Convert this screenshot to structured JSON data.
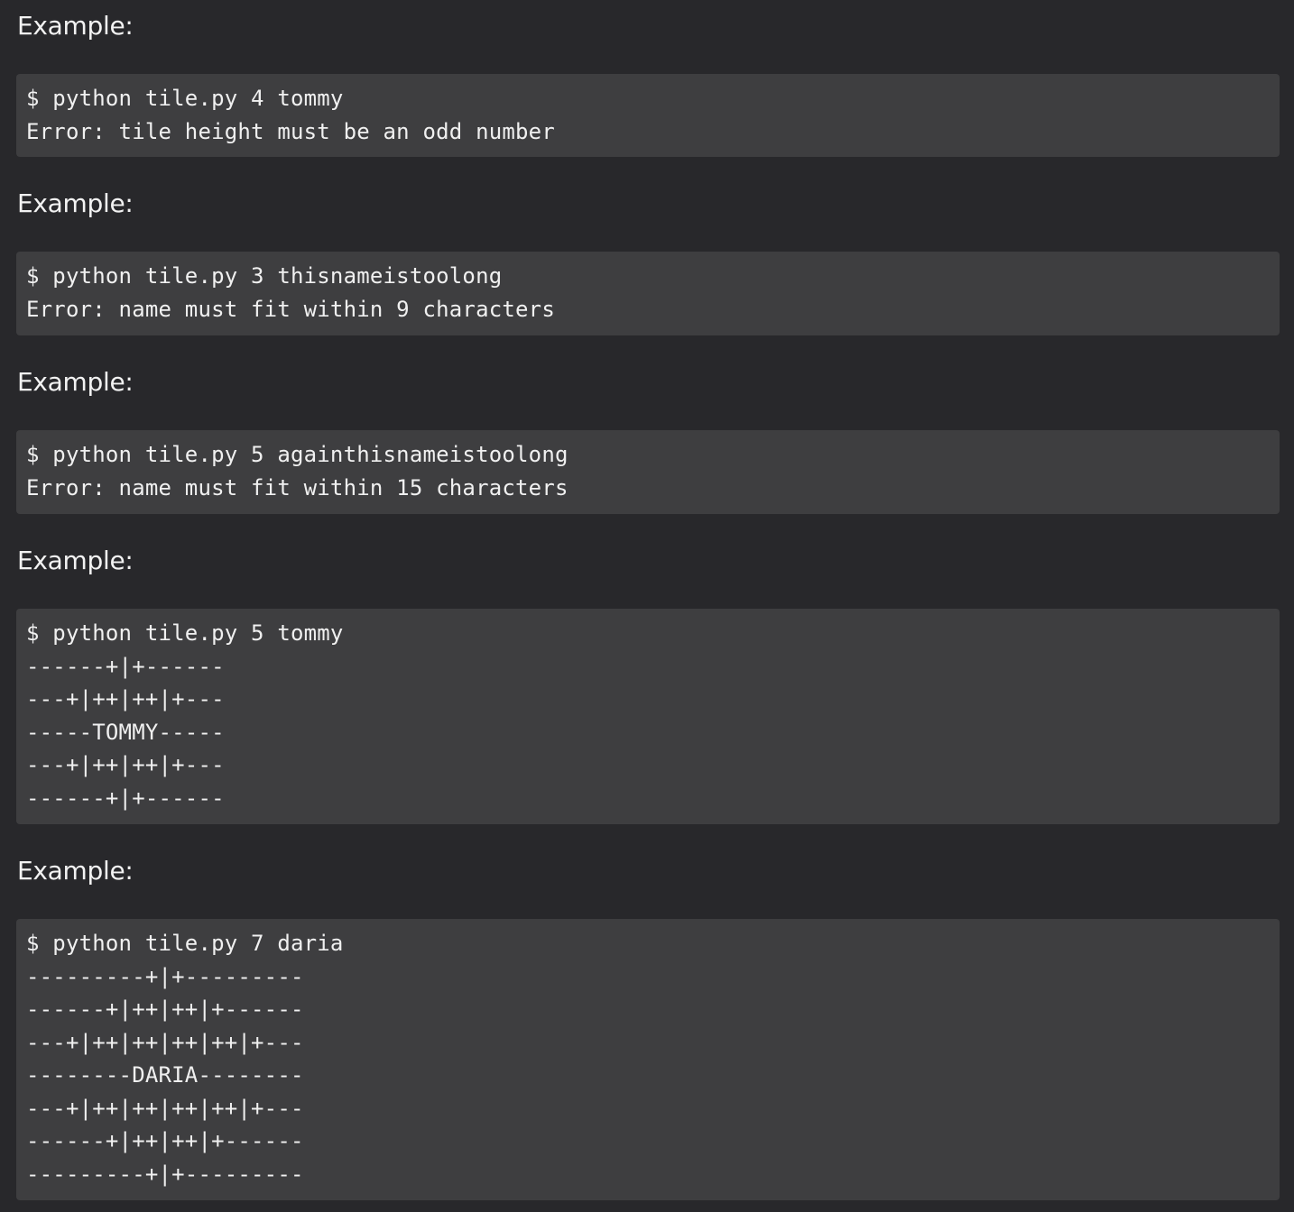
{
  "examples": [
    {
      "label": "Example:",
      "lines": [
        "$ python tile.py 4 tommy",
        "Error: tile height must be an odd number"
      ]
    },
    {
      "label": "Example:",
      "lines": [
        "$ python tile.py 3 thisnameistoolong",
        "Error: name must fit within 9 characters"
      ]
    },
    {
      "label": "Example:",
      "lines": [
        "$ python tile.py 5 againthisnameistoolong",
        "Error: name must fit within 15 characters"
      ]
    },
    {
      "label": "Example:",
      "lines": [
        "$ python tile.py 5 tommy",
        "------+|+------",
        "---+|++|++|+---",
        "-----TOMMY-----",
        "---+|++|++|+---",
        "------+|+------"
      ]
    },
    {
      "label": "Example:",
      "lines": [
        "$ python tile.py 7 daria",
        "---------+|+---------",
        "------+|++|++|+------",
        "---+|++|++|++|++|+---",
        "--------DARIA--------",
        "---+|++|++|++|++|+---",
        "------+|++|++|+------",
        "---------+|+---------"
      ]
    }
  ]
}
